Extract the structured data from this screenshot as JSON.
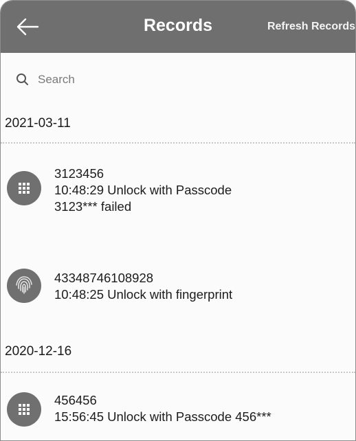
{
  "header": {
    "title": "Records",
    "refresh_label": "Refresh Records"
  },
  "search": {
    "placeholder": "Search"
  },
  "groups": [
    {
      "date": "2021-03-11",
      "records": [
        {
          "icon": "keypad-icon",
          "id": "3123456",
          "line1": "10:48:29 Unlock with Passcode",
          "line2": "3123*** failed"
        },
        {
          "icon": "fingerprint-icon",
          "id": "43348746108928",
          "line1": "10:48:25 Unlock with fingerprint",
          "line2": ""
        }
      ]
    },
    {
      "date": "2020-12-16",
      "records": [
        {
          "icon": "keypad-icon",
          "id": "456456",
          "line1": "15:56:45 Unlock with Passcode 456***",
          "line2": ""
        }
      ]
    }
  ],
  "colors": {
    "header_bg": "#6f6f6f",
    "icon_bg": "#707070"
  }
}
